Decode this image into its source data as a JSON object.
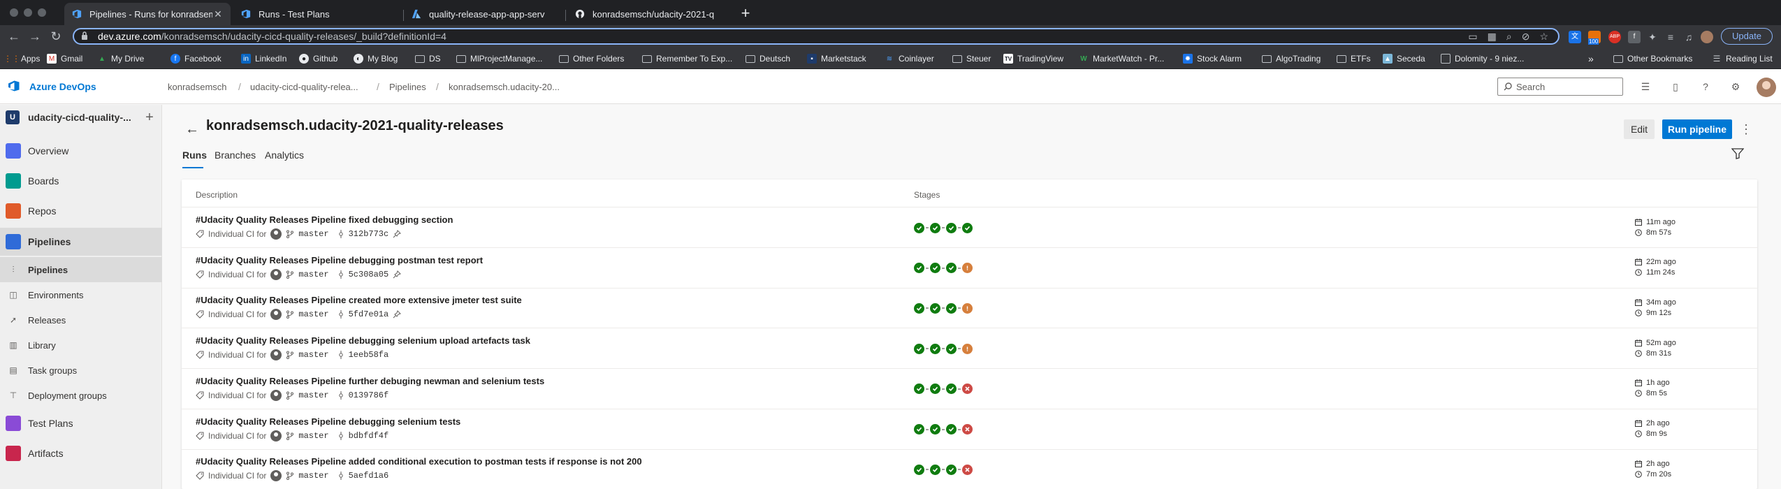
{
  "browser": {
    "tabs": [
      {
        "title": "Pipelines - Runs for konradsem",
        "icon": "azure-devops-icon",
        "active": true
      },
      {
        "title": "Runs - Test Plans",
        "icon": "azure-devops-icon",
        "active": false
      },
      {
        "title": "quality-release-app-app-serv",
        "icon": "azure-icon",
        "active": false
      },
      {
        "title": "konradsemsch/udacity-2021-q",
        "icon": "github-icon",
        "active": false
      }
    ],
    "url_host": "dev.azure.com",
    "url_path": "/konradsemsch/udacity-cicd-quality-releases/_build?definitionId=4",
    "update_label": "Update",
    "ext_badge": "100",
    "ext_abp": "ABP",
    "bookmarks": [
      {
        "label": "Apps",
        "icon": "apps-grid-icon"
      },
      {
        "label": "Gmail",
        "icon": "gmail-icon"
      },
      {
        "label": "My Drive",
        "icon": "drive-icon"
      },
      {
        "label": "Facebook",
        "icon": "facebook-icon"
      },
      {
        "label": "LinkedIn",
        "icon": "linkedin-icon"
      },
      {
        "label": "Github",
        "icon": "github-icon"
      },
      {
        "label": "My Blog",
        "icon": "blog-icon"
      },
      {
        "label": "DS",
        "icon": "folder-icon"
      },
      {
        "label": "MlProjectManage...",
        "icon": "folder-icon"
      },
      {
        "label": "Other Folders",
        "icon": "folder-icon"
      },
      {
        "label": "Remember To Exp...",
        "icon": "folder-icon"
      },
      {
        "label": "Deutsch",
        "icon": "folder-icon"
      },
      {
        "label": "Marketstack",
        "icon": "marketstack-icon"
      },
      {
        "label": "Coinlayer",
        "icon": "coinlayer-icon"
      },
      {
        "label": "Steuer",
        "icon": "folder-icon"
      },
      {
        "label": "TradingView",
        "icon": "tradingview-icon"
      },
      {
        "label": "MarketWatch - Pr...",
        "icon": "marketwatch-icon"
      },
      {
        "label": "Stock Alarm",
        "icon": "stock-alarm-icon"
      },
      {
        "label": "AlgoTrading",
        "icon": "folder-icon"
      },
      {
        "label": "ETFs",
        "icon": "folder-icon"
      },
      {
        "label": "Seceda",
        "icon": "seceda-icon"
      },
      {
        "label": "Dolomity - 9 niez...",
        "icon": "page-icon"
      }
    ],
    "other_bookmarks": "Other Bookmarks",
    "reading_list": "Reading List",
    "more_chevron": "»"
  },
  "header": {
    "app_name": "Azure DevOps",
    "breadcrumbs": [
      "konradsemsch",
      "udacity-cicd-quality-relea...",
      "Pipelines",
      "konradsemsch.udacity-20..."
    ],
    "search_placeholder": "Search"
  },
  "sidebar": {
    "project_badge": "U",
    "project_name": "udacity-cicd-quality-...",
    "items": [
      {
        "label": "Overview",
        "icon": "overview-icon",
        "color": "#4f6bed"
      },
      {
        "label": "Boards",
        "icon": "boards-icon",
        "color": "#009b8f"
      },
      {
        "label": "Repos",
        "icon": "repos-icon",
        "color": "#e05b2a"
      },
      {
        "label": "Pipelines",
        "icon": "pipelines-icon",
        "color": "#2f6bd8"
      }
    ],
    "subitems": [
      {
        "label": "Pipelines",
        "icon": "pipelines-sub-icon"
      },
      {
        "label": "Environments",
        "icon": "environments-icon"
      },
      {
        "label": "Releases",
        "icon": "releases-icon"
      },
      {
        "label": "Library",
        "icon": "library-icon"
      },
      {
        "label": "Task groups",
        "icon": "task-groups-icon"
      },
      {
        "label": "Deployment groups",
        "icon": "deployment-groups-icon"
      }
    ],
    "bottom_items": [
      {
        "label": "Test Plans",
        "icon": "test-plans-icon",
        "color": "#8a4bd6"
      },
      {
        "label": "Artifacts",
        "icon": "artifacts-icon",
        "color": "#c8264d"
      }
    ]
  },
  "page": {
    "title": "konradsemsch.udacity-2021-quality-releases",
    "edit_label": "Edit",
    "run_label": "Run pipeline",
    "more_label": "⋮",
    "tabs": [
      "Runs",
      "Branches",
      "Analytics"
    ],
    "columns": {
      "description": "Description",
      "stages": "Stages"
    },
    "trigger_label": "Individual CI for",
    "runs": [
      {
        "title": "#Udacity Quality Releases Pipeline fixed debugging section",
        "branch": "master",
        "commit": "312b773c",
        "pinned": true,
        "stages": [
          "ok",
          "ok",
          "ok",
          "ok"
        ],
        "when": "11m ago",
        "duration": "8m 57s"
      },
      {
        "title": "#Udacity Quality Releases Pipeline debugging postman test report",
        "branch": "master",
        "commit": "5c308a05",
        "pinned": true,
        "stages": [
          "ok",
          "ok",
          "ok",
          "warn"
        ],
        "when": "22m ago",
        "duration": "11m 24s"
      },
      {
        "title": "#Udacity Quality Releases Pipeline created more extensive jmeter test suite",
        "branch": "master",
        "commit": "5fd7e01a",
        "pinned": true,
        "stages": [
          "ok",
          "ok",
          "ok",
          "warn"
        ],
        "when": "34m ago",
        "duration": "9m 12s"
      },
      {
        "title": "#Udacity Quality Releases Pipeline debugging selenium upload artefacts task",
        "branch": "master",
        "commit": "1eeb58fa",
        "pinned": false,
        "stages": [
          "ok",
          "ok",
          "ok",
          "warn"
        ],
        "when": "52m ago",
        "duration": "8m 31s"
      },
      {
        "title": "#Udacity Quality Releases Pipeline further debuging newman and selenium tests",
        "branch": "master",
        "commit": "0139786f",
        "pinned": false,
        "stages": [
          "ok",
          "ok",
          "ok",
          "fail"
        ],
        "when": "1h ago",
        "duration": "8m 5s"
      },
      {
        "title": "#Udacity Quality Releases Pipeline debugging selenium tests",
        "branch": "master",
        "commit": "bdbfdf4f",
        "pinned": false,
        "stages": [
          "ok",
          "ok",
          "ok",
          "fail"
        ],
        "when": "2h ago",
        "duration": "8m 9s"
      },
      {
        "title": "#Udacity Quality Releases Pipeline added conditional execution to postman tests if response is not 200",
        "branch": "master",
        "commit": "5aefd1a6",
        "pinned": false,
        "stages": [
          "ok",
          "ok",
          "ok",
          "fail"
        ],
        "when": "2h ago",
        "duration": "7m 20s"
      }
    ]
  },
  "colors": {
    "accent": "#0078d4",
    "success": "#107c10",
    "warning": "#d67f3c",
    "failed": "#cd4a45"
  }
}
